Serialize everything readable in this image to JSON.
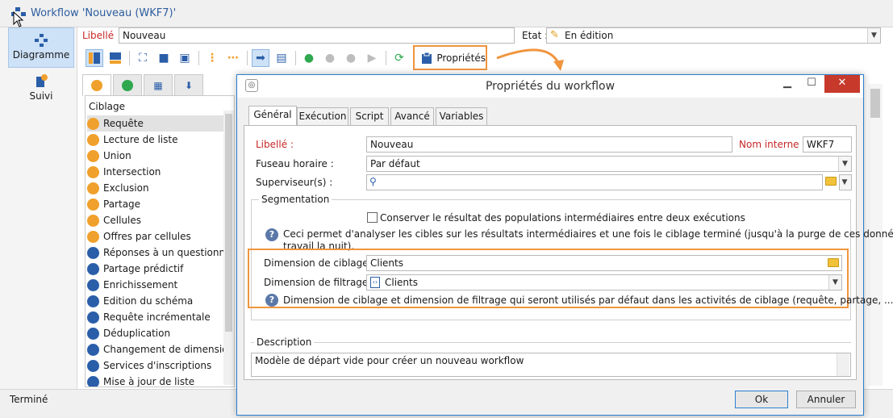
{
  "window": {
    "title": "Workflow 'Nouveau (WKF7)'"
  },
  "sidebar": {
    "items": [
      {
        "label": "Diagramme"
      },
      {
        "label": "Suivi"
      }
    ]
  },
  "header": {
    "libelle_label": "Libellé",
    "libelle_value": "Nouveau",
    "etat_label": "Etat :",
    "etat_value": "En édition"
  },
  "toolbar": {
    "proprietes_label": "Propriétés"
  },
  "palette": {
    "section": "Ciblage",
    "items": [
      {
        "label": "Requête",
        "color": "#f0a02c"
      },
      {
        "label": "Lecture de liste",
        "color": "#f0a02c"
      },
      {
        "label": "Union",
        "color": "#f0a02c"
      },
      {
        "label": "Intersection",
        "color": "#f0a02c"
      },
      {
        "label": "Exclusion",
        "color": "#f0a02c"
      },
      {
        "label": "Partage",
        "color": "#f0a02c"
      },
      {
        "label": "Cellules",
        "color": "#f0a02c"
      },
      {
        "label": "Offres par cellules",
        "color": "#f0a02c"
      },
      {
        "label": "Réponses à un questionna...",
        "color": "#2b5ea8"
      },
      {
        "label": "Partage prédictif",
        "color": "#2b5ea8"
      },
      {
        "label": "Enrichissement",
        "color": "#2b5ea8"
      },
      {
        "label": "Edition du schéma",
        "color": "#2b5ea8"
      },
      {
        "label": "Requête incrémentale",
        "color": "#2b5ea8"
      },
      {
        "label": "Déduplication",
        "color": "#2b5ea8"
      },
      {
        "label": "Changement de dimension",
        "color": "#2b5ea8"
      },
      {
        "label": "Services d'inscriptions",
        "color": "#2b5ea8"
      },
      {
        "label": "Mise à jour de liste",
        "color": "#2b5ea8"
      }
    ]
  },
  "status": {
    "text": "Terminé"
  },
  "dialog": {
    "title": "Propriétés du workflow",
    "tabs": [
      "Général",
      "Exécution",
      "Script",
      "Avancé",
      "Variables"
    ],
    "libelle_label": "Libellé :",
    "libelle_value": "Nouveau",
    "nom_interne_label": "Nom interne :",
    "nom_interne_value": "WKF7",
    "fuseau_label": "Fuseau horaire :",
    "fuseau_value": "Par défaut",
    "superviseur_label": "Superviseur(s) :",
    "superviseur_value": "",
    "segmentation_title": "Segmentation",
    "conserver_label": "Conserver le résultat des populations intermédiaires entre deux exécutions",
    "help1_line1": "Ceci permet d'analyser les cibles sur les résultats intermédiaires et une fois le ciblage terminé (jusqu'à la purge de ces données de",
    "help1_line2": "travail la nuit).",
    "dim_ciblage_label": "Dimension de ciblage :",
    "dim_ciblage_value": "Clients",
    "dim_filtrage_label": "Dimension de filtrage :",
    "dim_filtrage_value": "Clients",
    "help2": "Dimension de ciblage et dimension de filtrage qui seront utilisés par défaut dans les activités de ciblage (requête, partage, ...).",
    "description_title": "Description",
    "description_value": "Modèle de départ vide pour créer un nouveau workflow",
    "ok_label": "Ok",
    "annuler_label": "Annuler"
  },
  "colors": {
    "accent": "#2c7fd1",
    "highlight": "#f0953e",
    "required": "#c82727",
    "close": "#c7392b"
  }
}
